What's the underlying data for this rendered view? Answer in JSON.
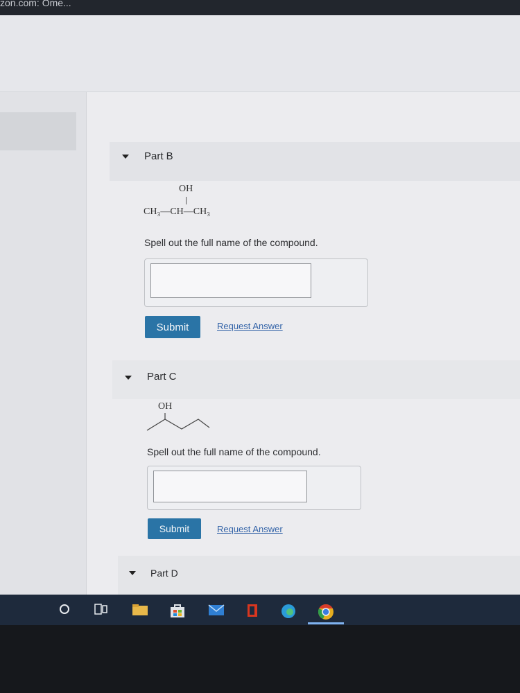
{
  "browser": {
    "tab_fragment": "zon.com: Ome..."
  },
  "parts": [
    {
      "title": "Part B",
      "formula": {
        "top": "OH",
        "main": "CH₃—CH—CH₃"
      },
      "prompt": "Spell out the full name of the compound.",
      "answer": "",
      "submit_label": "Submit",
      "request_label": "Request Answer"
    },
    {
      "title": "Part C",
      "formula": {
        "top": "OH"
      },
      "prompt": "Spell out the full name of the compound.",
      "answer": "",
      "submit_label": "Submit",
      "request_label": "Request Answer"
    },
    {
      "title": "Part D"
    }
  ],
  "colors": {
    "submit_bg": "#2a74a6",
    "link": "#3464a8",
    "taskbar": "#1e2a3c"
  },
  "taskbar": {
    "icons": [
      "cortana-icon",
      "task-view-icon",
      "file-explorer-icon",
      "store-icon",
      "mail-icon",
      "office-icon",
      "edge-icon",
      "chrome-icon"
    ]
  }
}
